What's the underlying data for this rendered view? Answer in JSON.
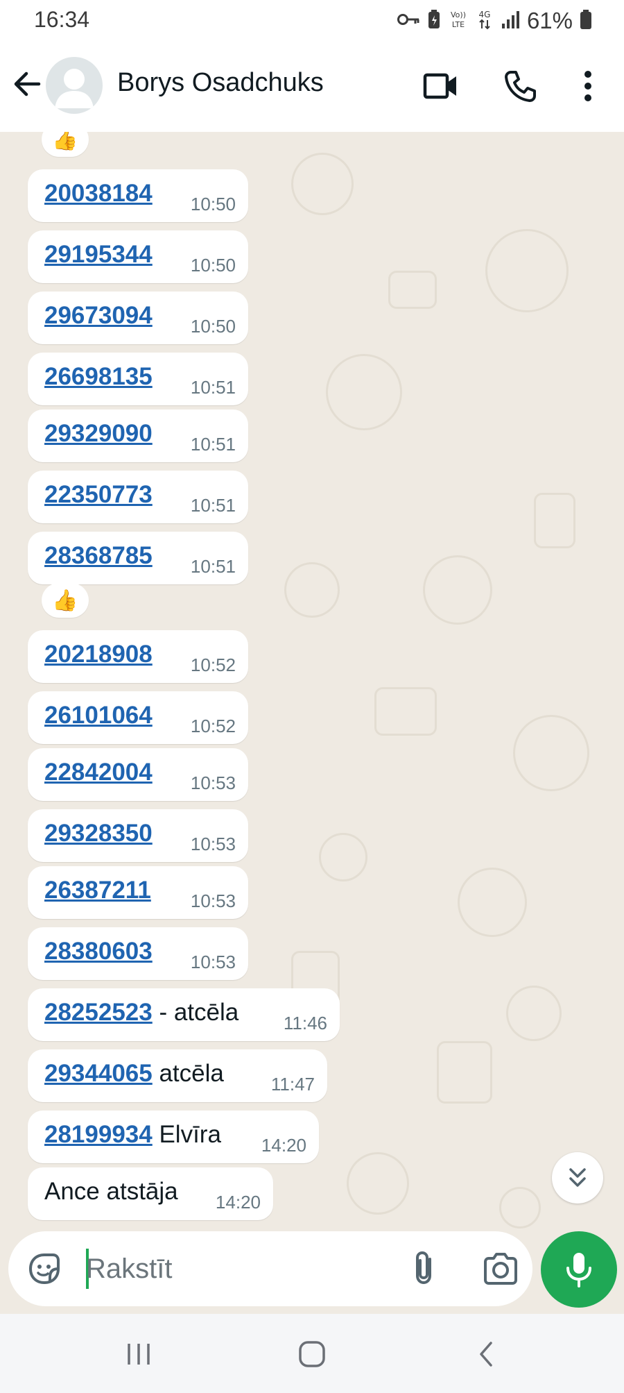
{
  "status_bar": {
    "time": "16:34",
    "battery_percent": "61%",
    "network_label": "4G",
    "volte_label": "VoLTE",
    "icons": [
      "key-icon",
      "battery-saver-icon",
      "volte-icon",
      "4g-icon",
      "signal-icon",
      "battery-icon"
    ]
  },
  "header": {
    "contact_name": "Borys Osadchuks",
    "icons": [
      "back-arrow-icon",
      "avatar-placeholder-icon",
      "video-call-icon",
      "voice-call-icon",
      "more-vert-icon"
    ]
  },
  "messages": [
    {
      "number": "20038184",
      "text": "",
      "time": "10:50"
    },
    {
      "number": "29195344",
      "text": "",
      "time": "10:50"
    },
    {
      "number": "29673094",
      "text": "",
      "time": "10:50"
    },
    {
      "number": "26698135",
      "text": "",
      "time": "10:51"
    },
    {
      "number": "29329090",
      "text": "",
      "time": "10:51"
    },
    {
      "number": "22350773",
      "text": "",
      "time": "10:51"
    },
    {
      "number": "28368785",
      "text": "",
      "time": "10:51"
    },
    {
      "number": "20218908",
      "text": "",
      "time": "10:52"
    },
    {
      "number": "26101064",
      "text": "",
      "time": "10:52"
    },
    {
      "number": "22842004",
      "text": "",
      "time": "10:53"
    },
    {
      "number": "29328350",
      "text": "",
      "time": "10:53"
    },
    {
      "number": "26387211",
      "text": "",
      "time": "10:53"
    },
    {
      "number": "28380603",
      "text": "",
      "time": "10:53"
    },
    {
      "number": "28252523",
      "text": " - atcēla",
      "time": "11:46"
    },
    {
      "number": "29344065",
      "text": " atcēla",
      "time": "11:47"
    },
    {
      "number": "28199934",
      "text": " Elvīra",
      "time": "14:20"
    },
    {
      "number": "",
      "text": "Ance atstāja",
      "time": "14:20"
    }
  ],
  "reactions": [
    "👍",
    "👍"
  ],
  "composer": {
    "placeholder": "Rakstīt",
    "value": "",
    "icons": [
      "sticker-emoji-icon",
      "attach-paperclip-icon",
      "camera-icon",
      "microphone-icon"
    ]
  },
  "scroll_down_icon": "double-chevron-down-icon",
  "nav_bar": {
    "icons": [
      "recent-apps-icon",
      "home-icon",
      "back-icon"
    ]
  },
  "colors": {
    "chat_background": "#efeae2",
    "bubble": "#ffffff",
    "link": "#1f64b1",
    "accent_green": "#1fa855",
    "timestamp": "#667781"
  }
}
